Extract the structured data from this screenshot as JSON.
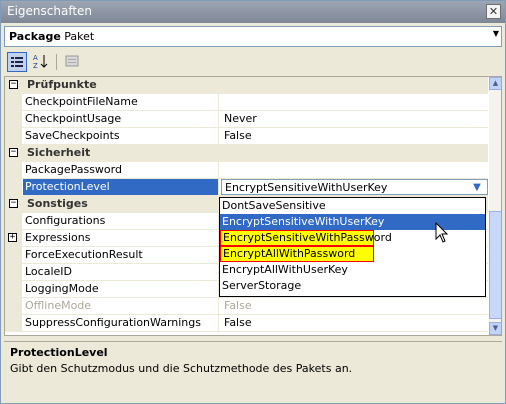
{
  "window": {
    "title": "Eigenschaften"
  },
  "object_selector": {
    "type": "Package",
    "name": "Paket"
  },
  "toolbar": {
    "categorized_icon": "categorized-icon",
    "alphabetical_icon": "alphabetical-sort-icon",
    "property_pages_icon": "property-pages-icon"
  },
  "categories": {
    "pruefpunkte": "Prüfpunkte",
    "sicherheit": "Sicherheit",
    "sonstiges": "Sonstiges"
  },
  "properties": {
    "checkpoint_file_name": {
      "name": "CheckpointFileName",
      "value": ""
    },
    "checkpoint_usage": {
      "name": "CheckpointUsage",
      "value": "Never"
    },
    "save_checkpoints": {
      "name": "SaveCheckpoints",
      "value": "False"
    },
    "package_password": {
      "name": "PackagePassword",
      "value": ""
    },
    "protection_level": {
      "name": "ProtectionLevel",
      "value": "EncryptSensitiveWithUserKey"
    },
    "configurations": {
      "name": "Configurations",
      "value": ""
    },
    "expressions": {
      "name": "Expressions",
      "value": ""
    },
    "force_execution_result": {
      "name": "ForceExecutionResult",
      "value": ""
    },
    "locale_id": {
      "name": "LocaleID",
      "value": ""
    },
    "logging_mode": {
      "name": "LoggingMode",
      "value": ""
    },
    "offline_mode": {
      "name": "OfflineMode",
      "value": "False"
    },
    "suppress_config_warnings": {
      "name": "SuppressConfigurationWarnings",
      "value": "False"
    }
  },
  "dropdown": {
    "options": [
      "DontSaveSensitive",
      "EncryptSensitiveWithUserKey",
      "EncryptSensitiveWithPassword",
      "EncryptAllWithPassword",
      "EncryptAllWithUserKey",
      "ServerStorage"
    ],
    "hover_index": 1
  },
  "help": {
    "title": "ProtectionLevel",
    "text": "Gibt den Schutzmodus und die Schutzmethode des Pakets an."
  },
  "colors": {
    "selection": "#316ac5",
    "highlight": "#ffff00",
    "highlight_border": "#ff0000"
  }
}
